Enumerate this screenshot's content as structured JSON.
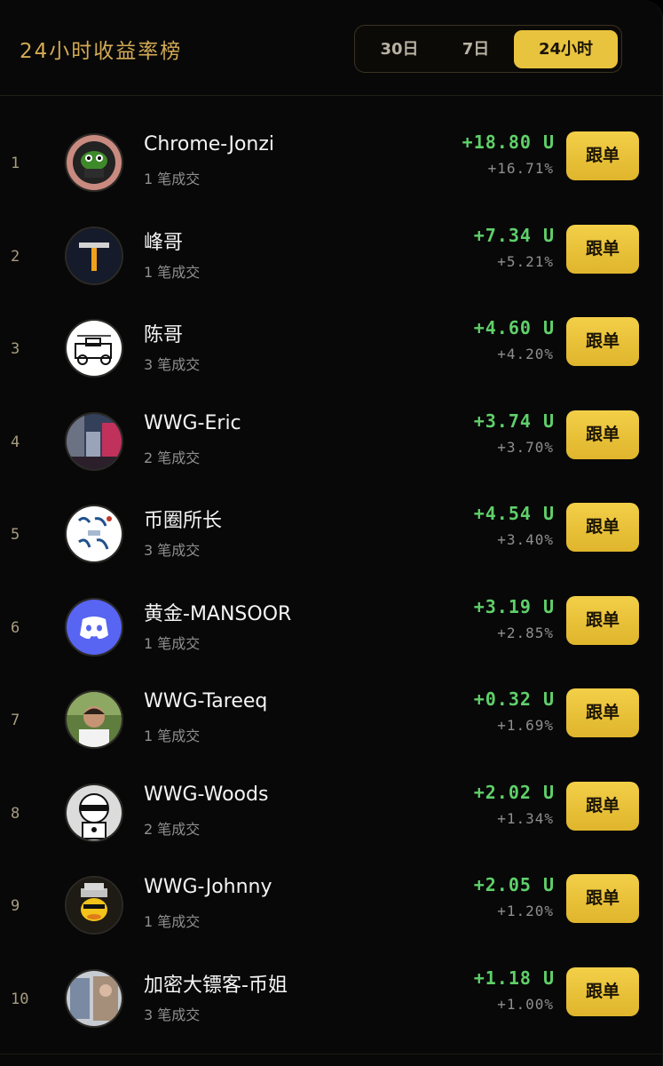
{
  "header": {
    "title": "24小时收益率榜",
    "tabs": [
      {
        "label": "30日",
        "active": false
      },
      {
        "label": "7日",
        "active": false
      },
      {
        "label": "24小时",
        "active": true
      }
    ]
  },
  "colors": {
    "accent": "#e8c33e",
    "profit": "#5fd06a",
    "muted": "#8f8f8f",
    "title": "#d4aa55"
  },
  "follow_label": "跟单",
  "rows": [
    {
      "rank": "1",
      "name": "Chrome-Jonzi",
      "trades": "1 笔成交",
      "profit": "+18.80 U",
      "pct": "+16.71%",
      "avatar": "pepe-avatar-icon"
    },
    {
      "rank": "2",
      "name": "峰哥",
      "trades": "1 笔成交",
      "profit": "+7.34 U",
      "pct": "+5.21%",
      "avatar": "letter-t-avatar-icon"
    },
    {
      "rank": "3",
      "name": "陈哥",
      "trades": "3 笔成交",
      "profit": "+4.60 U",
      "pct": "+4.20%",
      "avatar": "vintage-car-avatar-icon"
    },
    {
      "rank": "4",
      "name": "WWG-Eric",
      "trades": "2 笔成交",
      "profit": "+3.74 U",
      "pct": "+3.70%",
      "avatar": "city-photo-avatar-icon"
    },
    {
      "rank": "5",
      "name": "币圈所长",
      "trades": "3 笔成交",
      "profit": "+4.54 U",
      "pct": "+3.40%",
      "avatar": "calligraphy-avatar-icon"
    },
    {
      "rank": "6",
      "name": "黄金-MANSOOR",
      "trades": "1 笔成交",
      "profit": "+3.19 U",
      "pct": "+2.85%",
      "avatar": "discord-avatar-icon"
    },
    {
      "rank": "7",
      "name": "WWG-Tareeq",
      "trades": "1 笔成交",
      "profit": "+0.32 U",
      "pct": "+1.69%",
      "avatar": "person-photo-avatar-icon"
    },
    {
      "rank": "8",
      "name": "WWG-Woods",
      "trades": "2 笔成交",
      "profit": "+2.02 U",
      "pct": "+1.34%",
      "avatar": "cartoon-character-avatar-icon"
    },
    {
      "rank": "9",
      "name": "WWG-Johnny",
      "trades": "1 笔成交",
      "profit": "+2.05 U",
      "pct": "+1.20%",
      "avatar": "duck-hat-avatar-icon"
    },
    {
      "rank": "10",
      "name": "加密大镖客-币姐",
      "trades": "3 笔成交",
      "profit": "+1.18 U",
      "pct": "+1.00%",
      "avatar": "photo-collage-avatar-icon"
    }
  ]
}
